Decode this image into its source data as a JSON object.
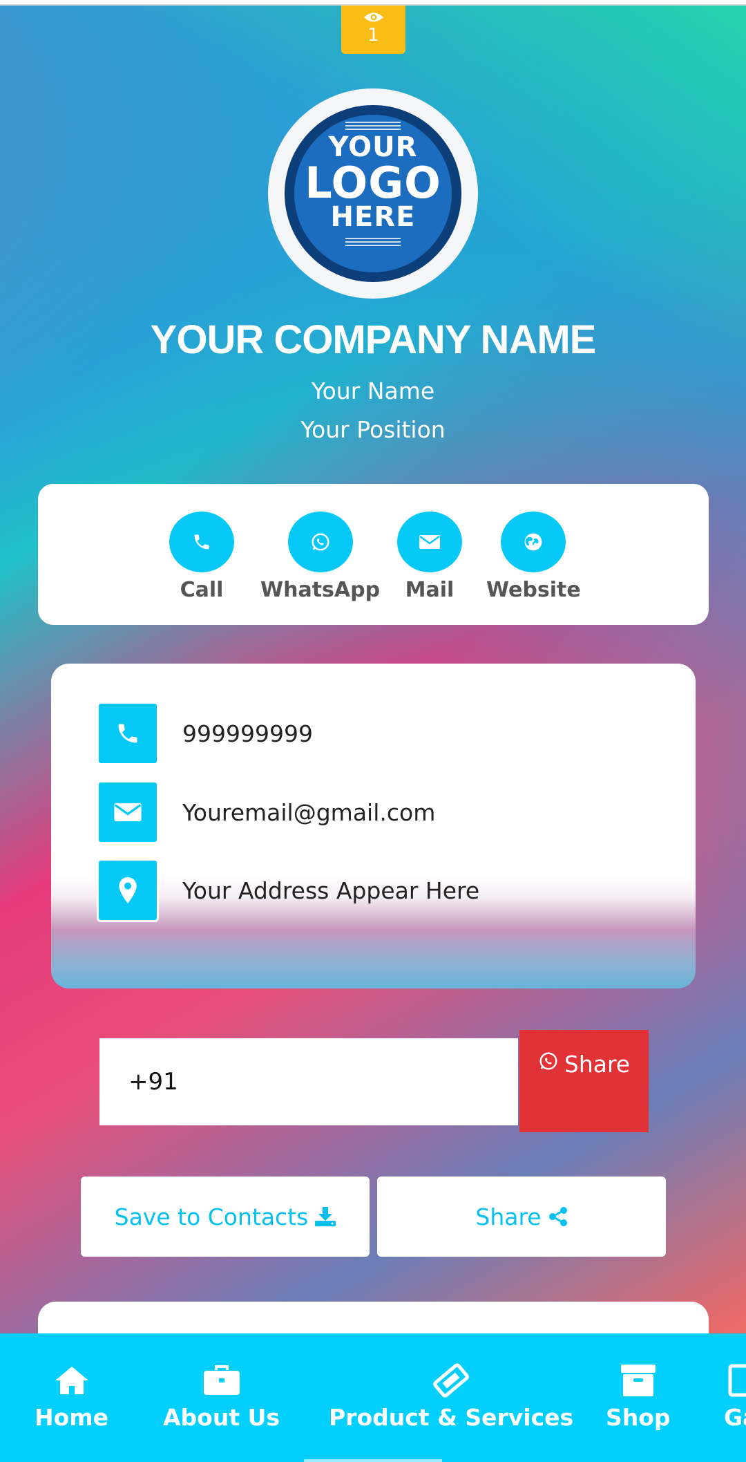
{
  "views": {
    "count": "1",
    "icon": "eye-icon"
  },
  "logo": {
    "line1": "YOUR",
    "line2": "LOGO",
    "line3": "HERE"
  },
  "profile": {
    "company": "YOUR COMPANY NAME",
    "name": "Your Name",
    "position": "Your Position"
  },
  "quick_actions": [
    {
      "label": "Call",
      "icon": "phone-icon"
    },
    {
      "label": "WhatsApp",
      "icon": "whatsapp-icon"
    },
    {
      "label": "Mail",
      "icon": "envelope-icon"
    },
    {
      "label": "Website",
      "icon": "globe-icon"
    }
  ],
  "contact": {
    "phone": "999999999",
    "email": "Youremail@gmail.com",
    "address": "Your Address Appear Here"
  },
  "whatsapp_share": {
    "input_value": "+91",
    "button_label": "Share"
  },
  "actions": {
    "save_label": "Save to Contacts",
    "share_label": "Share"
  },
  "bottom_nav": [
    {
      "label": "Home",
      "icon": "home-icon"
    },
    {
      "label": "About Us",
      "icon": "briefcase-icon"
    },
    {
      "label": "Product & Services",
      "icon": "ticket-icon"
    },
    {
      "label": "Shop",
      "icon": "archive-box-icon"
    },
    {
      "label": "Ga",
      "icon": "gallery-icon"
    }
  ],
  "colors": {
    "accent": "#06c9f7",
    "whatsapp_button": "#e03237",
    "views_badge": "#f9bd15"
  }
}
